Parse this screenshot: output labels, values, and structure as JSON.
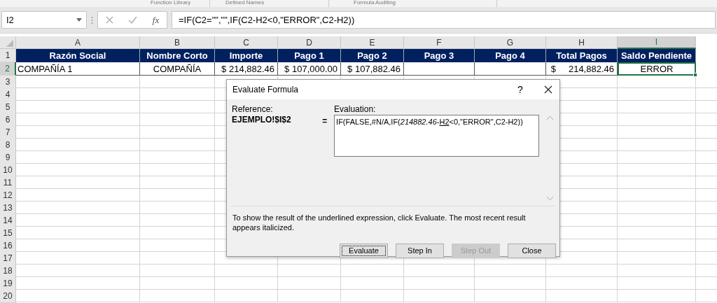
{
  "ribbon_groups": [
    "Function Library",
    "Defined Names",
    "Formula Auditing"
  ],
  "name_box": {
    "value": "I2"
  },
  "formula_bar": {
    "icon_text": "fx",
    "value": "=IF(C2=\"\",\"\",IF(C2-H2<0,\"ERROR\",C2-H2))"
  },
  "sheet": {
    "columns": [
      {
        "label": "A",
        "selected": false
      },
      {
        "label": "B",
        "selected": false
      },
      {
        "label": "C",
        "selected": false
      },
      {
        "label": "D",
        "selected": false
      },
      {
        "label": "E",
        "selected": false
      },
      {
        "label": "F",
        "selected": false
      },
      {
        "label": "G",
        "selected": false
      },
      {
        "label": "H",
        "selected": false
      },
      {
        "label": "I",
        "selected": true
      }
    ],
    "row_headers": [
      {
        "label": "1",
        "selected": false
      },
      {
        "label": "2",
        "selected": true
      },
      {
        "label": "3",
        "selected": false
      },
      {
        "label": "4",
        "selected": false
      },
      {
        "label": "5",
        "selected": false
      },
      {
        "label": "6",
        "selected": false
      },
      {
        "label": "7",
        "selected": false
      },
      {
        "label": "8",
        "selected": false
      },
      {
        "label": "9",
        "selected": false
      },
      {
        "label": "10",
        "selected": false
      },
      {
        "label": "11",
        "selected": false
      },
      {
        "label": "12",
        "selected": false
      },
      {
        "label": "13",
        "selected": false
      },
      {
        "label": "14",
        "selected": false
      },
      {
        "label": "15",
        "selected": false
      },
      {
        "label": "16",
        "selected": false
      },
      {
        "label": "17",
        "selected": false
      },
      {
        "label": "18",
        "selected": false
      },
      {
        "label": "19",
        "selected": false
      },
      {
        "label": "20",
        "selected": false
      }
    ],
    "header_row": [
      "Razón Social",
      "Nombre Corto",
      "Importe",
      "Pago 1",
      "Pago 2",
      "Pago 3",
      "Pago 4",
      "Total Pagos",
      "Saldo Pendiente"
    ],
    "data_row": [
      {
        "text": "COMPAÑÍA 1",
        "selected": false
      },
      {
        "text": "COMPAÑÍA",
        "selected": false
      },
      {
        "text": "$ 214,882.46",
        "selected": false
      },
      {
        "text": "$ 107,000.00",
        "selected": false
      },
      {
        "text": "$ 107,882.46",
        "selected": false
      },
      {
        "selected": false
      },
      {
        "selected": false
      },
      {
        "text": "$     214,882.46",
        "selected": false
      },
      {
        "text": "ERROR",
        "selected": true
      }
    ]
  },
  "dialog": {
    "title": "Evaluate Formula",
    "help": "?",
    "reference_label": "Reference:",
    "reference": "EJEMPLO!$I$2",
    "equals": "=",
    "evaluation_label": "Evaluation:",
    "evaluation": {
      "before": "IF(FALSE,#N/A,IF(*214882.46*-",
      "underlined": "H2",
      "after": "<0,\"ERROR\",C2-H2))"
    },
    "hint": "To show the result of the underlined expression, click Evaluate.  The most recent result appears italicized.",
    "buttons": [
      {
        "label": "Evaluate",
        "disabled": false,
        "focused": true
      },
      {
        "label": "Step In",
        "disabled": false,
        "focused": false
      },
      {
        "label": "Step Out",
        "disabled": true,
        "focused": false
      },
      {
        "label": "Close",
        "disabled": false,
        "focused": false
      }
    ]
  }
}
